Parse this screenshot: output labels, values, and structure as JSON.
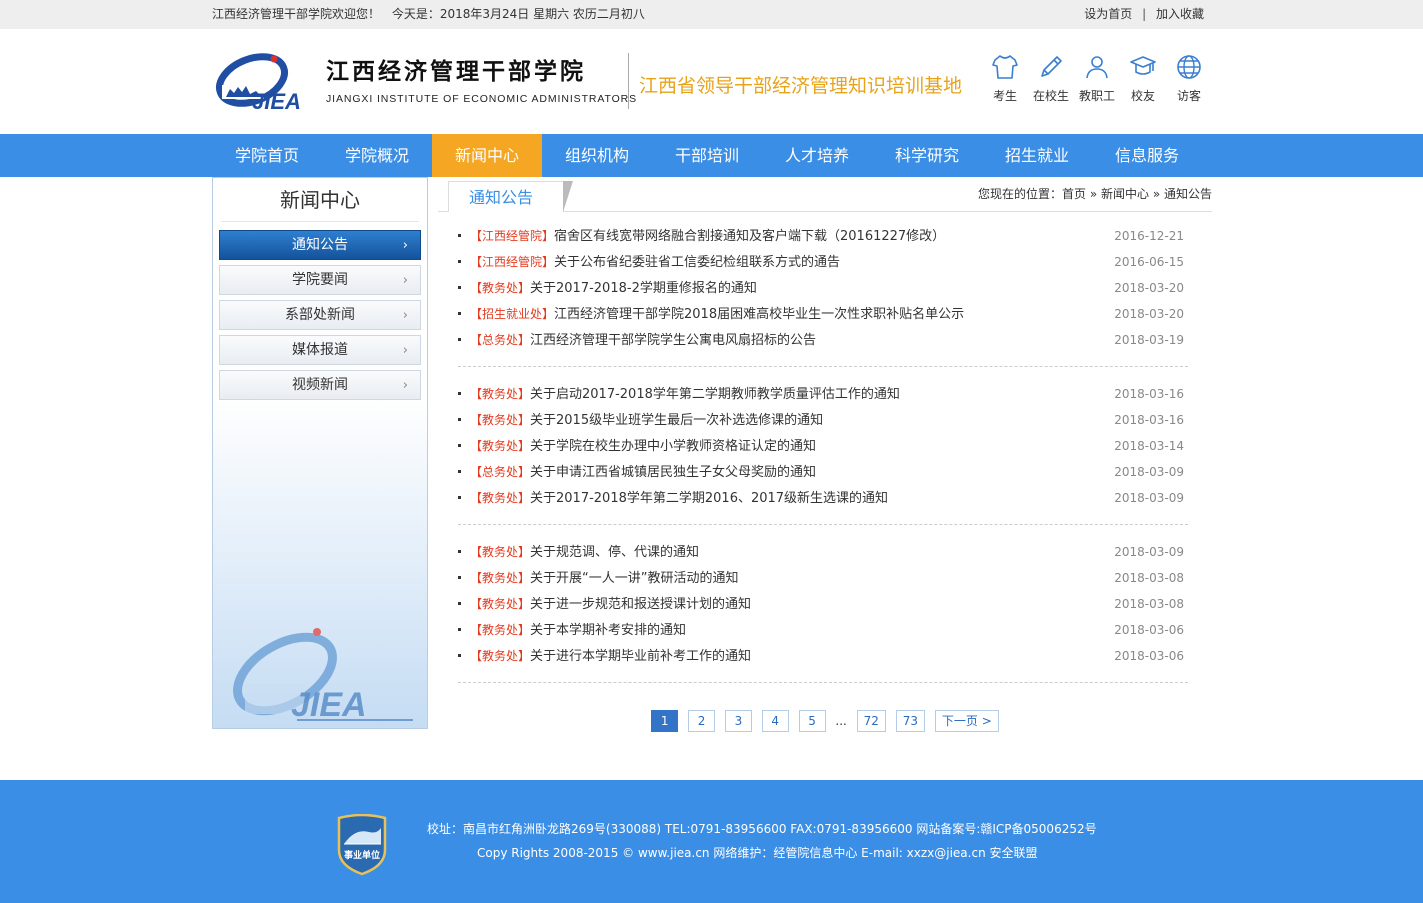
{
  "topbar": {
    "welcome": "江西经济管理干部学院欢迎您！",
    "date": "今天是：2018年3月24日 星期六 农历二月初八",
    "set_home": "设为首页",
    "separator": "|",
    "favorite": "加入收藏"
  },
  "header": {
    "logo_letters": "JIEA",
    "school_cn": "江西经济管理干部学院",
    "school_en": "JIANGXI INSTITUTE OF ECONOMIC ADMINISTRATORS",
    "slogan": "江西省领导干部经济管理知识培训基地",
    "quick_links": [
      {
        "label": "考生",
        "icon": "tshirt-icon"
      },
      {
        "label": "在校生",
        "icon": "pencil-icon"
      },
      {
        "label": "教职工",
        "icon": "user-icon"
      },
      {
        "label": "校友",
        "icon": "graduation-cap-icon"
      },
      {
        "label": "访客",
        "icon": "globe-icon"
      }
    ]
  },
  "nav": [
    "学院首页",
    "学院概况",
    "新闻中心",
    "组织机构",
    "干部培训",
    "人才培养",
    "科学研究",
    "招生就业",
    "信息服务"
  ],
  "nav_active": "新闻中心",
  "sidebar": {
    "title": "新闻中心",
    "items": [
      "通知公告",
      "学院要闻",
      "系部处新闻",
      "媒体报道",
      "视频新闻"
    ],
    "arrow": "›",
    "watermark": "JIEA"
  },
  "content": {
    "tab": "通知公告",
    "breadcrumb": "您现在的位置：首页 » 新闻中心 » 通知公告"
  },
  "news_groups": [
    [
      {
        "tag": "【江西经管院】",
        "title": "宿舍区有线宽带网络融合割接通知及客户端下载（20161227修改）",
        "date": "2016-12-21"
      },
      {
        "tag": "【江西经管院】",
        "title": "关于公布省纪委驻省工信委纪检组联系方式的通告",
        "date": "2016-06-15"
      },
      {
        "tag": "【教务处】",
        "title": "关于2017-2018-2学期重修报名的通知",
        "date": "2018-03-20"
      },
      {
        "tag": "【招生就业处】",
        "title": "江西经济管理干部学院2018届困难高校毕业生一次性求职补贴名单公示",
        "date": "2018-03-20"
      },
      {
        "tag": "【总务处】",
        "title": "江西经济管理干部学院学生公寓电风扇招标的公告",
        "date": "2018-03-19"
      }
    ],
    [
      {
        "tag": "【教务处】",
        "title": "关于启动2017-2018学年第二学期教师教学质量评估工作的通知",
        "date": "2018-03-16"
      },
      {
        "tag": "【教务处】",
        "title": "关于2015级毕业班学生最后一次补选选修课的通知",
        "date": "2018-03-16"
      },
      {
        "tag": "【教务处】",
        "title": "关于学院在校生办理中小学教师资格证认定的通知",
        "date": "2018-03-14"
      },
      {
        "tag": "【总务处】",
        "title": "关于申请江西省城镇居民独生子女父母奖励的通知",
        "date": "2018-03-09"
      },
      {
        "tag": "【教务处】",
        "title": "关于2017-2018学年第二学期2016、2017级新生选课的通知",
        "date": "2018-03-09"
      }
    ],
    [
      {
        "tag": "【教务处】",
        "title": "关于规范调、停、代课的通知",
        "date": "2018-03-09"
      },
      {
        "tag": "【教务处】",
        "title": "关于开展“一人一讲”教研活动的通知",
        "date": "2018-03-08"
      },
      {
        "tag": "【教务处】",
        "title": "关于进一步规范和报送授课计划的通知",
        "date": "2018-03-08"
      },
      {
        "tag": "【教务处】",
        "title": "关于本学期补考安排的通知",
        "date": "2018-03-06"
      },
      {
        "tag": "【教务处】",
        "title": "关于进行本学期毕业前补考工作的通知",
        "date": "2018-03-06"
      }
    ]
  ],
  "pager": {
    "pages": [
      "1",
      "2",
      "3",
      "4",
      "5"
    ],
    "current": "1",
    "dots": "...",
    "tail": [
      "72",
      "73"
    ],
    "next": "下一页 >"
  },
  "footer": {
    "badge_text": "事业单位",
    "line1": "校址：南昌市红角洲卧龙路269号(330088) TEL:0791-83956600 FAX:0791-83956600 网站备案号:赣ICP备05006252号",
    "line2": "Copy Rights 2008-2015 © www.jiea.cn 网络维护：经管院信息中心 E-mail: xxzx@jiea.cn 安全联盟"
  },
  "colors": {
    "primary_blue": "#3a8ee6",
    "active_orange": "#f5a623",
    "slogan_gold": "#e8a31a",
    "tag_red": "#e23b20"
  }
}
